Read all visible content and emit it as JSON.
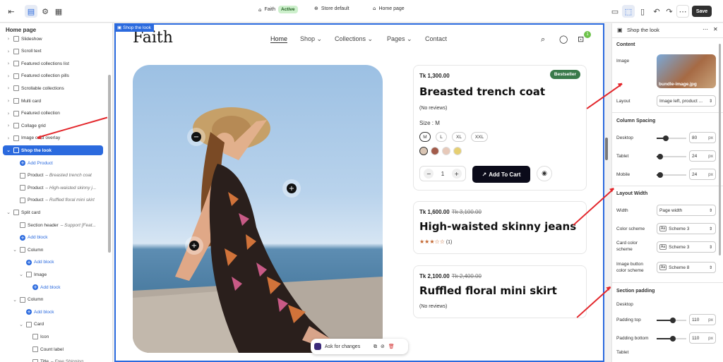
{
  "topbar": {
    "theme_name": "Faith",
    "theme_status": "Active",
    "store": "Store default",
    "page": "Home page",
    "save_label": "Save"
  },
  "left_panel": {
    "title": "Home page",
    "items": [
      {
        "label": "Slideshow",
        "level": 1,
        "chevron": "›",
        "kind": "section"
      },
      {
        "label": "Scroll text",
        "level": 1,
        "chevron": "›",
        "kind": "section"
      },
      {
        "label": "Featured collections list",
        "level": 1,
        "chevron": "›",
        "kind": "section"
      },
      {
        "label": "Featured collection pills",
        "level": 1,
        "chevron": "›",
        "kind": "section"
      },
      {
        "label": "Scrollable collections",
        "level": 1,
        "chevron": "›",
        "kind": "section"
      },
      {
        "label": "Multi card",
        "level": 1,
        "chevron": "›",
        "kind": "section"
      },
      {
        "label": "Featured collection",
        "level": 1,
        "chevron": "›",
        "kind": "section"
      },
      {
        "label": "Collage grid",
        "level": 1,
        "chevron": "›",
        "kind": "section"
      },
      {
        "label": "Image card overlay",
        "level": 1,
        "chevron": "›",
        "kind": "section"
      },
      {
        "label": "Shop the look",
        "level": 1,
        "chevron": "⌄",
        "kind": "section",
        "selected": true
      },
      {
        "label": "Add Product",
        "level": 2,
        "kind": "add"
      },
      {
        "label": "Product",
        "suffix": " – Breasted trench coat",
        "level": 2,
        "kind": "block"
      },
      {
        "label": "Product",
        "suffix": " – High-waisted skinny j...",
        "level": 2,
        "kind": "block"
      },
      {
        "label": "Product",
        "suffix": " – Ruffled floral mini skirt",
        "level": 2,
        "kind": "block"
      },
      {
        "label": "Split card",
        "level": 1,
        "chevron": "⌄",
        "kind": "section"
      },
      {
        "label": "Section header",
        "suffix": " – Support [Feat...",
        "level": 2,
        "kind": "block"
      },
      {
        "label": "Add block",
        "level": 2,
        "kind": "add"
      },
      {
        "label": "Column",
        "level": 2,
        "chevron": "⌄",
        "kind": "block"
      },
      {
        "label": "Add block",
        "level": 3,
        "kind": "add"
      },
      {
        "label": "Image",
        "level": 3,
        "chevron": "⌄",
        "kind": "block"
      },
      {
        "label": "Add block",
        "level": 4,
        "kind": "add"
      },
      {
        "label": "Column",
        "level": 2,
        "chevron": "⌄",
        "kind": "block"
      },
      {
        "label": "Add block",
        "level": 3,
        "kind": "add"
      },
      {
        "label": "Card",
        "level": 3,
        "chevron": "⌄",
        "kind": "block"
      },
      {
        "label": "Icon",
        "level": 4,
        "kind": "block"
      },
      {
        "label": "Count label",
        "level": 4,
        "kind": "block"
      },
      {
        "label": "Title",
        "suffix": " – Free Shipping",
        "level": 4,
        "kind": "block"
      }
    ]
  },
  "canvas": {
    "section_tag": "Shop the look",
    "logo": "Faith",
    "nav": [
      "Home",
      "Shop ⌄",
      "Collections ⌄",
      "Pages ⌄",
      "Contact"
    ],
    "cart_count": "1",
    "products": [
      {
        "price": "Tk 1,300.00",
        "compare_price": "",
        "badge": "Bestseller",
        "title": "Breasted trench coat",
        "reviews": "(No reviews)",
        "size_label": "Size : M",
        "sizes": [
          "M",
          "L",
          "XL",
          "XXL"
        ],
        "quantity": "1",
        "cta": "Add To Cart"
      },
      {
        "price": "Tk 1,600.00",
        "compare_price": "Tk 3,100.00",
        "title": "High-waisted skinny jeans",
        "stars": "★★★☆☆",
        "reviews": "(1)",
        "rating": 3
      },
      {
        "price": "Tk 2,100.00",
        "compare_price": "Tk 2,400.00",
        "title": "Ruffled floral mini skirt",
        "reviews": "(No reviews)"
      }
    ],
    "ask_bar": "Ask for changes"
  },
  "right_panel": {
    "title": "Shop the look",
    "content_heading": "Content",
    "image_label": "Image",
    "image_name": "bundle-image.jpg",
    "layout_label": "Layout",
    "layout_value": "Image left, product ...",
    "spacing_heading": "Column Spacing",
    "spacing": [
      {
        "label": "Desktop",
        "value": "80",
        "unit": "px",
        "fraction": 0.3
      },
      {
        "label": "Tablet",
        "value": "24",
        "unit": "px",
        "fraction": 0.12
      },
      {
        "label": "Mobile",
        "value": "24",
        "unit": "px",
        "fraction": 0.12
      }
    ],
    "width_heading": "Layout Width",
    "width_label": "Width",
    "width_value": "Page width",
    "color_scheme_label": "Color scheme",
    "color_scheme_value": "Scheme 3",
    "card_color_label": "Card color scheme",
    "card_color_value": "Scheme 3",
    "button_color_label": "Image button color scheme",
    "button_color_value": "Scheme 8",
    "padding_heading": "Section padding",
    "padding_sub": "Desktop",
    "padding": [
      {
        "label": "Padding top",
        "value": "110",
        "unit": "px",
        "fraction": 0.55
      },
      {
        "label": "Padding bottom",
        "value": "110",
        "unit": "px",
        "fraction": 0.55
      }
    ],
    "tablet_label": "Tablet"
  },
  "colors": {
    "accent": "#2b6ade",
    "annotation_arrow": "#e3262b",
    "badge_green": "#3a7a4a",
    "cta_dark": "#0b0b1a"
  }
}
